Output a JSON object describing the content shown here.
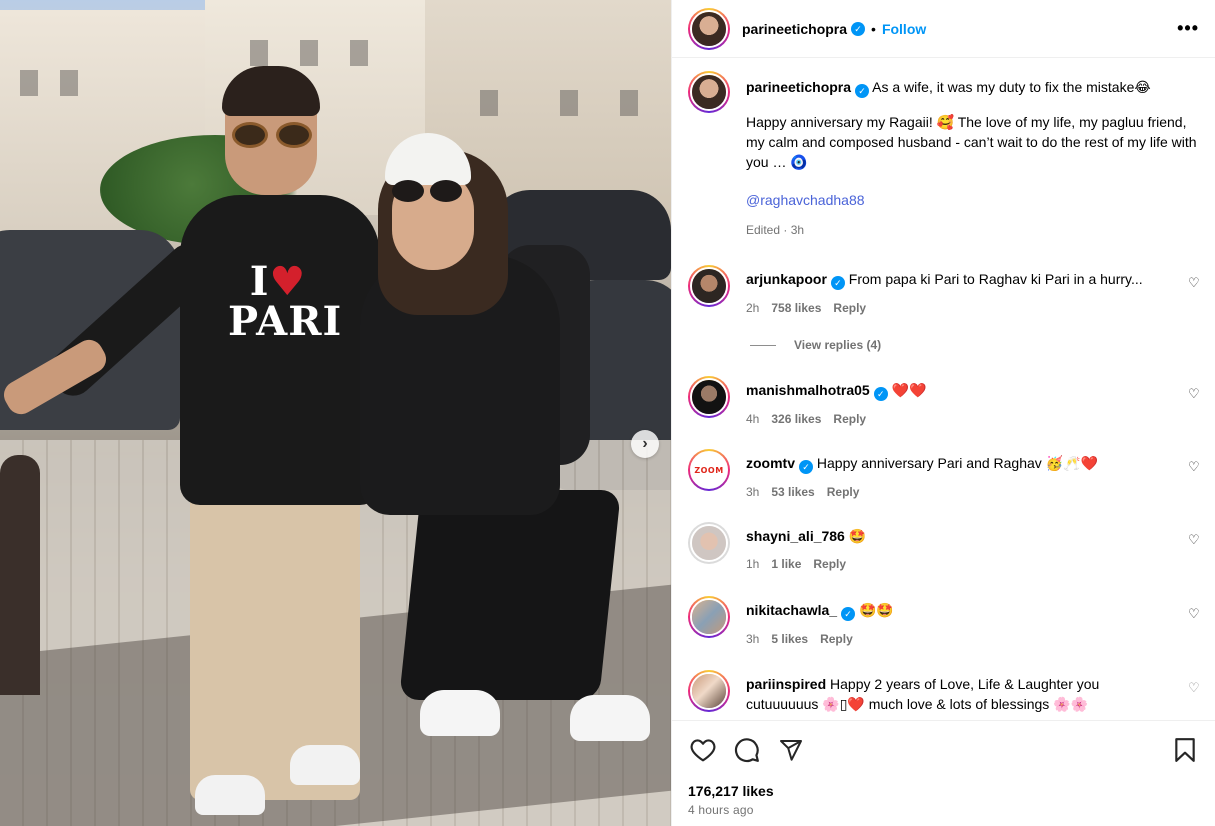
{
  "post": {
    "author": "parineetichopra",
    "follow_label": "Follow",
    "separator": "•",
    "more_label": "•••",
    "carousel_next": "›",
    "caption_line1": "As a wife, it was my duty to fix the mistake😂",
    "caption_line2": "Happy anniversary my Ragaii! 🥰 The love of my life, my pagluu friend, my calm and composed husband - can’t wait to do the rest of my life with you … 🧿",
    "caption_mention": "@raghavchadha88",
    "caption_meta": "Edited · 3h",
    "shirt_text_top": "I",
    "shirt_heart": "♥",
    "shirt_text_bottom": "PARI"
  },
  "comments": [
    {
      "user": "arjunkapoor",
      "verified": true,
      "text": "From papa ki Pari to Raghav ki Pari in a hurry...",
      "time": "2h",
      "likes": "758 likes",
      "reply": "Reply"
    },
    {
      "user": "manishmalhotra05",
      "verified": true,
      "text": "❤️❤️",
      "time": "4h",
      "likes": "326 likes",
      "reply": "Reply"
    },
    {
      "user": "zoomtv",
      "verified": true,
      "text": "Happy anniversary Pari and Raghav 🥳🥂❤️",
      "time": "3h",
      "likes": "53 likes",
      "reply": "Reply"
    },
    {
      "user": "shayni_ali_786",
      "verified": false,
      "text": "🤩",
      "time": "1h",
      "likes": "1 like",
      "reply": "Reply"
    },
    {
      "user": "nikitachawla_",
      "verified": true,
      "text": "🤩🤩",
      "time": "3h",
      "likes": "5 likes",
      "reply": "Reply"
    },
    {
      "user": "pariinspired",
      "verified": false,
      "text": "Happy 2 years of Love, Life & Laughter you cutuuuuuus 🌸▯❤️ much love & lots of blessings 🌸🌸",
      "time": "",
      "likes": "",
      "reply": ""
    }
  ],
  "view_replies": "View replies (4)",
  "zoom_logo_text": "ZOOM",
  "footer": {
    "likes": "176,217 likes",
    "time": "4 hours ago"
  },
  "colors": {
    "accent": "#0095f6",
    "mention": "#4a63d8",
    "muted": "#737373"
  },
  "icons": [
    "heart-icon",
    "comment-icon",
    "share-icon",
    "bookmark-icon",
    "verified-icon",
    "more-icon"
  ]
}
